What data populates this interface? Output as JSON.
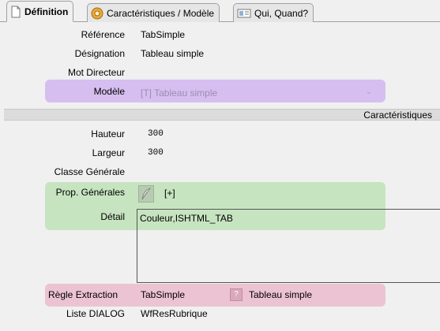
{
  "tabs": [
    {
      "label": "Définition",
      "icon": "document-icon",
      "active": true
    },
    {
      "label": "Caractéristiques / Modèle",
      "icon": "settings-medal-icon",
      "active": false
    },
    {
      "label": "Qui, Quand?",
      "icon": "id-card-icon",
      "active": false
    }
  ],
  "fields": {
    "reference": {
      "label": "Référence",
      "value": "TabSimple"
    },
    "designation": {
      "label": "Désignation",
      "value": "Tableau simple"
    },
    "mot_directeur": {
      "label": "Mot Directeur",
      "value": ""
    },
    "modele": {
      "label": "Modèle",
      "value": "[T] Tableau simple"
    }
  },
  "section_title": "Caractéristiques",
  "characteristics": {
    "hauteur": {
      "label": "Hauteur",
      "value": "300"
    },
    "largeur": {
      "label": "Largeur",
      "value": "300"
    },
    "classe_generale": {
      "label": "Classe Générale",
      "value": ""
    },
    "prop_generales": {
      "label": "Prop. Générales",
      "value": "[+]"
    },
    "detail": {
      "label": "Détail",
      "value": "Couleur,ISHTML_TAB"
    },
    "regle_extraction": {
      "label": "Règle Extraction",
      "value": "TabSimple",
      "linked_label": "Tableau simple"
    },
    "liste_dialog": {
      "label": "Liste DIALOG",
      "value": "WfResRubrique"
    }
  },
  "colors": {
    "modele_highlight": "#d6bff0",
    "props_highlight": "#c7e4c0",
    "regle_highlight": "#ecc3d2"
  }
}
